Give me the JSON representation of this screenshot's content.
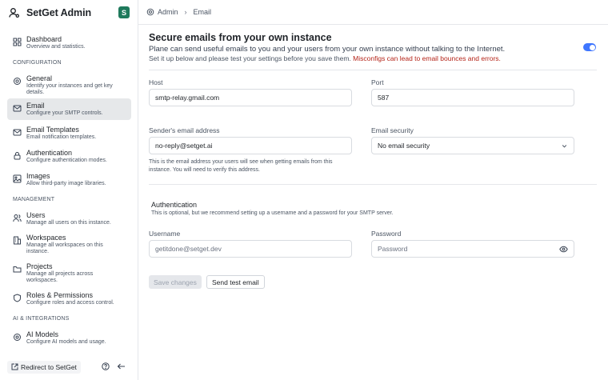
{
  "brand": {
    "name": "SetGet Admin",
    "badge": "S",
    "badge_color": "#1f7a5c"
  },
  "breadcrumb": {
    "root": "Admin",
    "current": "Email"
  },
  "sidebar": {
    "items": [
      {
        "title": "Dashboard",
        "desc": "Overview and statistics."
      },
      {
        "title": "General",
        "desc": "Identify your instances and get key details."
      },
      {
        "title": "Email",
        "desc": "Configure your SMTP controls."
      },
      {
        "title": "Email Templates",
        "desc": "Email notification templates."
      },
      {
        "title": "Authentication",
        "desc": "Configure authentication modes."
      },
      {
        "title": "Images",
        "desc": "Allow third-party image libraries."
      },
      {
        "title": "Users",
        "desc": "Manage all users on this instance."
      },
      {
        "title": "Workspaces",
        "desc": "Manage all workspaces on this instance."
      },
      {
        "title": "Projects",
        "desc": "Manage all projects across workspaces."
      },
      {
        "title": "Roles & Permissions",
        "desc": "Configure roles and access control."
      },
      {
        "title": "AI Models",
        "desc": "Configure AI models and usage."
      }
    ],
    "sections": {
      "configuration": "CONFIGURATION",
      "management": "MANAGEMENT",
      "ai": "AI & INTEGRATIONS"
    },
    "footer": {
      "redirect_label": "Redirect to SetGet"
    }
  },
  "page": {
    "title": "Secure emails from your own instance",
    "desc": "Plane can send useful emails to you and your users from your own instance without talking to the Internet.",
    "sub": "Set it up below and please test your settings before you save them.",
    "warning": "Misconfigs can lead to email bounces and errors.",
    "toggle_on": true,
    "accent_color": "#3f76ff"
  },
  "form": {
    "host": {
      "label": "Host",
      "value": "smtp-relay.gmail.com"
    },
    "port": {
      "label": "Port",
      "value": "587"
    },
    "sender": {
      "label": "Sender's email address",
      "value": "no-reply@setget.ai",
      "help": "This is the email address your users will see when getting emails from this instance. You will need to verify this address."
    },
    "security": {
      "label": "Email security",
      "value": "No email security"
    },
    "auth": {
      "title": "Authentication",
      "desc": "This is optional, but we recommend setting up a username and a password for your SMTP server."
    },
    "username": {
      "label": "Username",
      "placeholder": "getitdone@setget.dev"
    },
    "password": {
      "label": "Password",
      "placeholder": "Password"
    },
    "save_label": "Save changes",
    "test_label": "Send test email"
  }
}
